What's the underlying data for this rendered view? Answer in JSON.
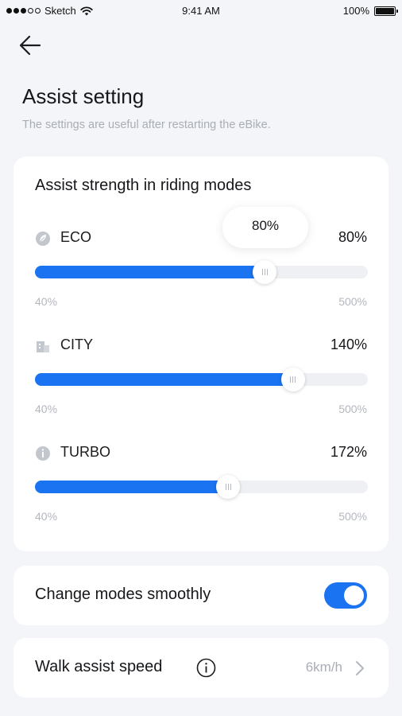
{
  "status_bar": {
    "carrier": "Sketch",
    "time": "9:41 AM",
    "battery": "100%",
    "icons": [
      "signal-dots-icon",
      "wifi-icon",
      "battery-icon"
    ]
  },
  "header": {
    "back_icon": "arrow-left-icon",
    "title": "Assist setting",
    "subtitle": "The settings are useful after restarting the eBike."
  },
  "assist": {
    "heading": "Assist strength in riding modes",
    "modes": [
      {
        "label": "ECO",
        "value": "80%",
        "min": "40%",
        "max": "500%",
        "fill": 0.69,
        "icon": "leaf-icon",
        "tooltip": "80%"
      },
      {
        "label": "CITY",
        "value": "140%",
        "min": "40%",
        "max": "500%",
        "fill": 0.775,
        "icon": "building-icon"
      },
      {
        "label": "TURBO",
        "value": "172%",
        "min": "40%",
        "max": "500%",
        "fill": 0.58,
        "icon": "turbo-icon"
      }
    ]
  },
  "smooth": {
    "label": "Change modes smoothly",
    "enabled": true
  },
  "walk": {
    "label": "Walk assist speed",
    "value": "6km/h",
    "icons": [
      "info-icon",
      "chevron-right-icon"
    ]
  },
  "colors": {
    "accent": "#1a73f0",
    "background": "#f4f5f9",
    "muted_text": "#a9adb5",
    "track": "#eef0f3"
  }
}
